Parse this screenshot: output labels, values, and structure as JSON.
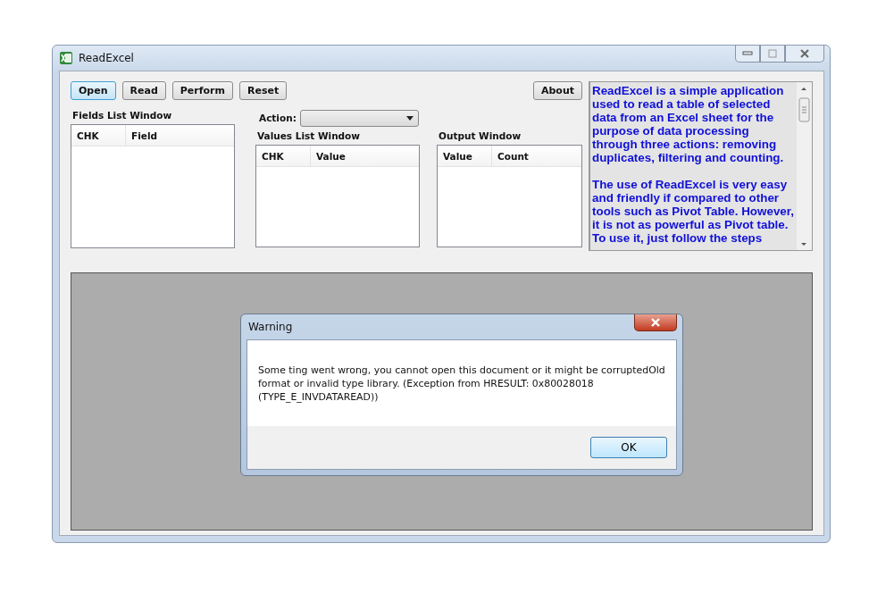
{
  "window": {
    "title": "ReadExcel"
  },
  "buttons": [
    {
      "label": "Open",
      "focused": true
    },
    {
      "label": "Read",
      "focused": false
    },
    {
      "label": "Perform",
      "focused": false
    },
    {
      "label": "Reset",
      "focused": false
    }
  ],
  "about_button": {
    "label": "About",
    "focused": false
  },
  "fields_list": {
    "title": "Fields List Window",
    "columns": [
      "CHK",
      "Field"
    ]
  },
  "action": {
    "label": "Action:"
  },
  "values_list": {
    "title": "Values List Window",
    "columns": [
      "CHK",
      "Value"
    ]
  },
  "output_list": {
    "title": "Output Window",
    "columns": [
      "Value",
      "Count"
    ]
  },
  "about_text": [
    "ReadExcel is a simple application used to read a table of selected data from an Excel sheet for the purpose of data processing through three actions: removing duplicates, filtering and counting.",
    "The use of ReadExcel is very easy and friendly if compared to other tools such as Pivot Table. However, it is not as powerful as Pivot table. To use it, just follow the steps"
  ],
  "dialog": {
    "title": "Warning",
    "message": "Some ting went wrong, you cannot open this document or it might be corruptedOld format or invalid type library. (Exception from HRESULT: 0x80028018 (TYPE_E_INVDATAREAD))",
    "button": {
      "label": "OK",
      "focused": true
    }
  }
}
